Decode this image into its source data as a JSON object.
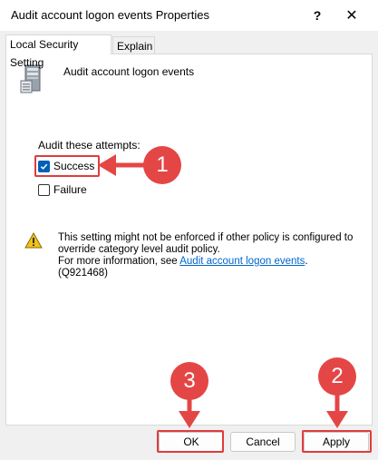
{
  "window": {
    "title": "Audit account logon events Properties",
    "help_glyph": "?",
    "close_glyph": "✕"
  },
  "tabs": [
    {
      "label": "Local Security Setting",
      "active": true
    },
    {
      "label": "Explain",
      "active": false
    }
  ],
  "policy": {
    "icon": "server-icon",
    "name": "Audit account logon events"
  },
  "audit": {
    "label": "Audit these attempts:",
    "options": [
      {
        "label": "Success",
        "checked": true
      },
      {
        "label": "Failure",
        "checked": false
      }
    ]
  },
  "warning": {
    "icon": "warning-icon",
    "line1": "This setting might not be enforced if other policy is configured to override category level audit policy.",
    "line2_prefix": "For more information, see ",
    "link_text": "Audit account logon events",
    "line2_suffix": ". (Q921468)"
  },
  "buttons": {
    "ok": "OK",
    "cancel": "Cancel",
    "apply": "Apply"
  },
  "annotations": {
    "accent_color": "#e44646",
    "markers": [
      "1",
      "2",
      "3"
    ]
  }
}
